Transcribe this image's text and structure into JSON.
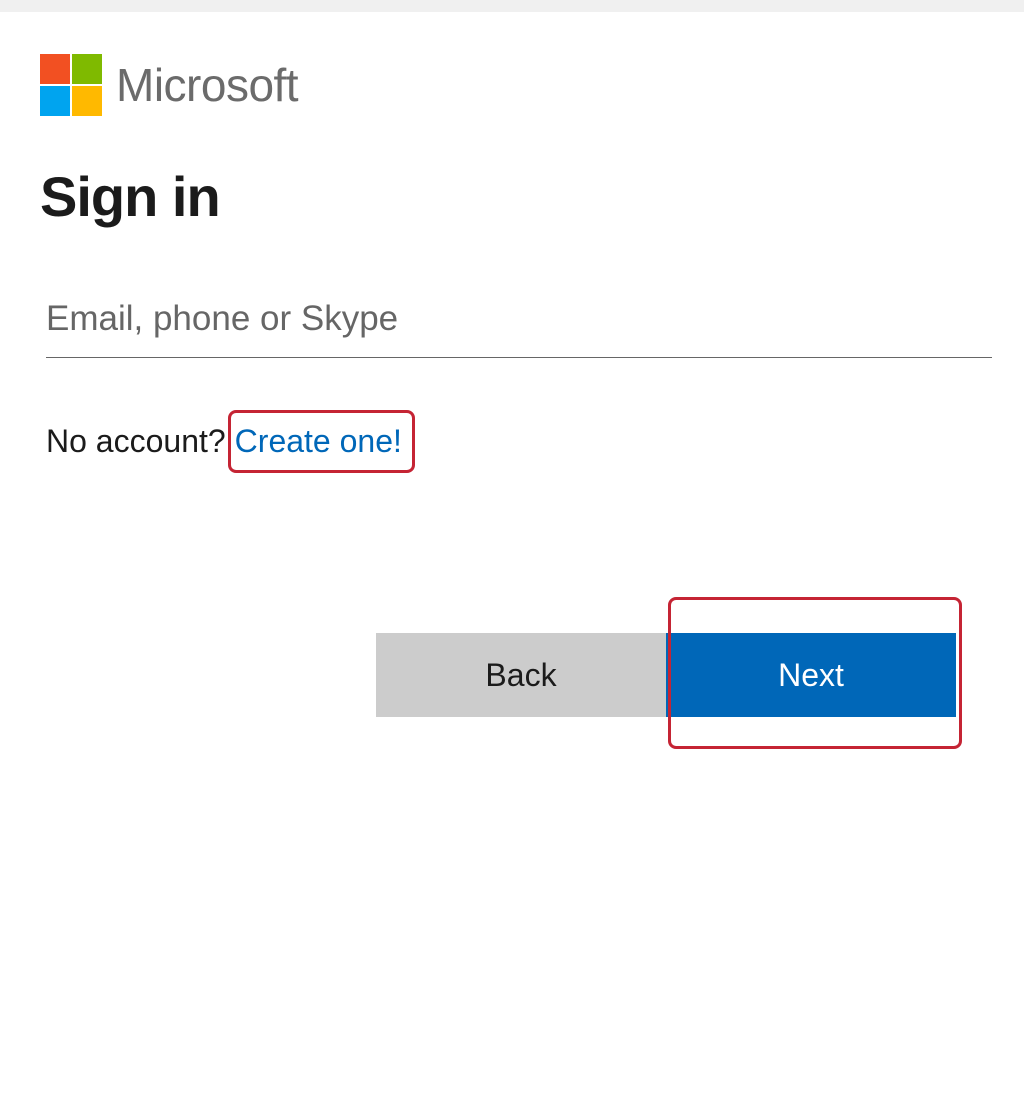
{
  "brand": {
    "name": "Microsoft",
    "logo_colors": {
      "top_left": "#f25022",
      "top_right": "#7fba00",
      "bottom_left": "#00a4ef",
      "bottom_right": "#ffb900"
    }
  },
  "heading": "Sign in",
  "input": {
    "placeholder": "Email, phone or Skype",
    "value": ""
  },
  "create_account": {
    "prompt": "No account?",
    "link_text": "Create one!"
  },
  "buttons": {
    "back": "Back",
    "next": "Next"
  },
  "colors": {
    "highlight_border": "#c52434",
    "link": "#0067b8",
    "primary_button": "#0067b8",
    "secondary_button": "#cccccc"
  }
}
